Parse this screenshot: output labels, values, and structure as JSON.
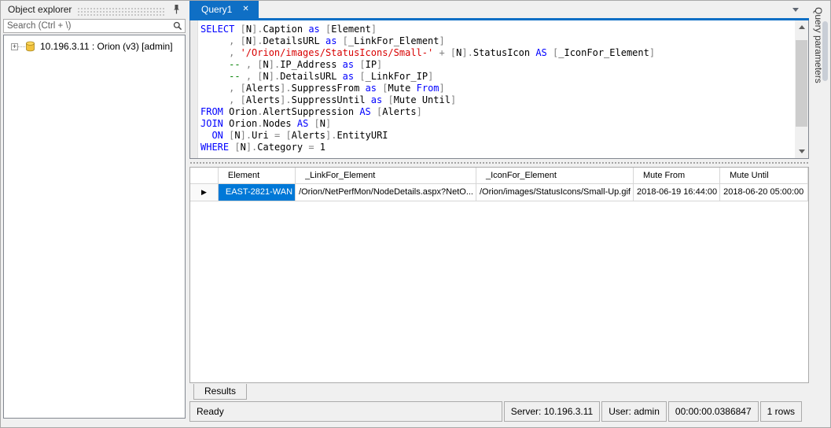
{
  "colors": {
    "accent": "#0f6fc5",
    "selection": "#0078d7",
    "kw": "#0000ff",
    "str": "#d80000",
    "com": "#008000",
    "ident": "#000000",
    "punct": "#808080"
  },
  "object_explorer": {
    "title": "Object explorer",
    "search_placeholder": "Search (Ctrl + \\)",
    "tree": [
      {
        "expander": "+",
        "icon": "database-icon",
        "label": "10.196.3.11 : Orion (v3) [admin]"
      }
    ]
  },
  "editor": {
    "tab": "Query1",
    "close_glyph": "✕",
    "sql_lines": [
      [
        [
          "k",
          "SELECT"
        ],
        [
          "n",
          " "
        ],
        [
          "b",
          "["
        ],
        [
          "i",
          "N"
        ],
        [
          "b",
          "]."
        ],
        [
          "i",
          "Caption"
        ],
        [
          "n",
          " "
        ],
        [
          "k",
          "as"
        ],
        [
          "n",
          " "
        ],
        [
          "b",
          "["
        ],
        [
          "i",
          "Element"
        ],
        [
          "b",
          "]"
        ]
      ],
      [
        [
          "n",
          "     "
        ],
        [
          "b",
          ", ["
        ],
        [
          "i",
          "N"
        ],
        [
          "b",
          "]."
        ],
        [
          "i",
          "DetailsURL"
        ],
        [
          "n",
          " "
        ],
        [
          "k",
          "as"
        ],
        [
          "n",
          " "
        ],
        [
          "b",
          "["
        ],
        [
          "i",
          "_LinkFor_Element"
        ],
        [
          "b",
          "]"
        ]
      ],
      [
        [
          "n",
          "     "
        ],
        [
          "b",
          ", "
        ],
        [
          "s",
          "'/Orion/images/StatusIcons/Small-'"
        ],
        [
          "n",
          " "
        ],
        [
          "b",
          "+"
        ],
        [
          "n",
          " "
        ],
        [
          "b",
          "["
        ],
        [
          "i",
          "N"
        ],
        [
          "b",
          "]."
        ],
        [
          "i",
          "StatusIcon"
        ],
        [
          "n",
          " "
        ],
        [
          "k",
          "AS"
        ],
        [
          "n",
          " "
        ],
        [
          "b",
          "["
        ],
        [
          "i",
          "_IconFor_Element"
        ],
        [
          "b",
          "]"
        ]
      ],
      [
        [
          "n",
          "     "
        ],
        [
          "c",
          "--"
        ],
        [
          "n",
          " "
        ],
        [
          "b",
          ", ["
        ],
        [
          "i",
          "N"
        ],
        [
          "b",
          "]."
        ],
        [
          "i",
          "IP_Address"
        ],
        [
          "n",
          " "
        ],
        [
          "k",
          "as"
        ],
        [
          "n",
          " "
        ],
        [
          "b",
          "["
        ],
        [
          "i",
          "IP"
        ],
        [
          "b",
          "]"
        ]
      ],
      [
        [
          "n",
          "     "
        ],
        [
          "c",
          "--"
        ],
        [
          "n",
          " "
        ],
        [
          "b",
          ", ["
        ],
        [
          "i",
          "N"
        ],
        [
          "b",
          "]."
        ],
        [
          "i",
          "DetailsURL"
        ],
        [
          "n",
          " "
        ],
        [
          "k",
          "as"
        ],
        [
          "n",
          " "
        ],
        [
          "b",
          "["
        ],
        [
          "i",
          "_LinkFor_IP"
        ],
        [
          "b",
          "]"
        ]
      ],
      [
        [
          "n",
          "     "
        ],
        [
          "b",
          ", ["
        ],
        [
          "i",
          "Alerts"
        ],
        [
          "b",
          "]."
        ],
        [
          "i",
          "SuppressFrom"
        ],
        [
          "n",
          " "
        ],
        [
          "k",
          "as"
        ],
        [
          "n",
          " "
        ],
        [
          "b",
          "["
        ],
        [
          "i",
          "Mute"
        ],
        [
          "n",
          " "
        ],
        [
          "k",
          "From"
        ],
        [
          "b",
          "]"
        ]
      ],
      [
        [
          "n",
          "     "
        ],
        [
          "b",
          ", ["
        ],
        [
          "i",
          "Alerts"
        ],
        [
          "b",
          "]."
        ],
        [
          "i",
          "SuppressUntil"
        ],
        [
          "n",
          " "
        ],
        [
          "k",
          "as"
        ],
        [
          "n",
          " "
        ],
        [
          "b",
          "["
        ],
        [
          "i",
          "Mute Until"
        ],
        [
          "b",
          "]"
        ]
      ],
      [
        [
          "k",
          "FROM"
        ],
        [
          "n",
          " "
        ],
        [
          "i",
          "Orion"
        ],
        [
          "b",
          "."
        ],
        [
          "i",
          "AlertSuppression"
        ],
        [
          "n",
          " "
        ],
        [
          "k",
          "AS"
        ],
        [
          "n",
          " "
        ],
        [
          "b",
          "["
        ],
        [
          "i",
          "Alerts"
        ],
        [
          "b",
          "]"
        ]
      ],
      [
        [
          "k",
          "JOIN"
        ],
        [
          "n",
          " "
        ],
        [
          "i",
          "Orion"
        ],
        [
          "b",
          "."
        ],
        [
          "i",
          "Nodes"
        ],
        [
          "n",
          " "
        ],
        [
          "k",
          "AS"
        ],
        [
          "n",
          " "
        ],
        [
          "b",
          "["
        ],
        [
          "i",
          "N"
        ],
        [
          "b",
          "]"
        ]
      ],
      [
        [
          "n",
          "  "
        ],
        [
          "k",
          "ON"
        ],
        [
          "n",
          " "
        ],
        [
          "b",
          "["
        ],
        [
          "i",
          "N"
        ],
        [
          "b",
          "]."
        ],
        [
          "i",
          "Uri"
        ],
        [
          "n",
          " "
        ],
        [
          "b",
          "="
        ],
        [
          "n",
          " "
        ],
        [
          "b",
          "["
        ],
        [
          "i",
          "Alerts"
        ],
        [
          "b",
          "]."
        ],
        [
          "i",
          "EntityURI"
        ]
      ],
      [
        [
          "k",
          "WHERE"
        ],
        [
          "n",
          " "
        ],
        [
          "b",
          "["
        ],
        [
          "i",
          "N"
        ],
        [
          "b",
          "]."
        ],
        [
          "i",
          "Category"
        ],
        [
          "n",
          " "
        ],
        [
          "b",
          "="
        ],
        [
          "n",
          " "
        ],
        [
          "i",
          "1"
        ]
      ]
    ]
  },
  "results": {
    "tab": "Results",
    "row_marker": "▶",
    "columns": [
      "Element",
      "_LinkFor_Element",
      "_IconFor_Element",
      "Mute From",
      "Mute Until"
    ],
    "rows": [
      [
        "EAST-2821-WAN",
        "/Orion/NetPerfMon/NodeDetails.aspx?NetO...",
        "/Orion/images/StatusIcons/Small-Up.gif",
        "2018-06-19 16:44:00",
        "2018-06-20 05:00:00"
      ]
    ]
  },
  "status_bar": {
    "ready": "Ready",
    "server": "Server: 10.196.3.11",
    "user": "User: admin",
    "time": "00:00:00.0386847",
    "rows": "1 rows"
  },
  "right_panel": {
    "tab": "Query parameters"
  }
}
